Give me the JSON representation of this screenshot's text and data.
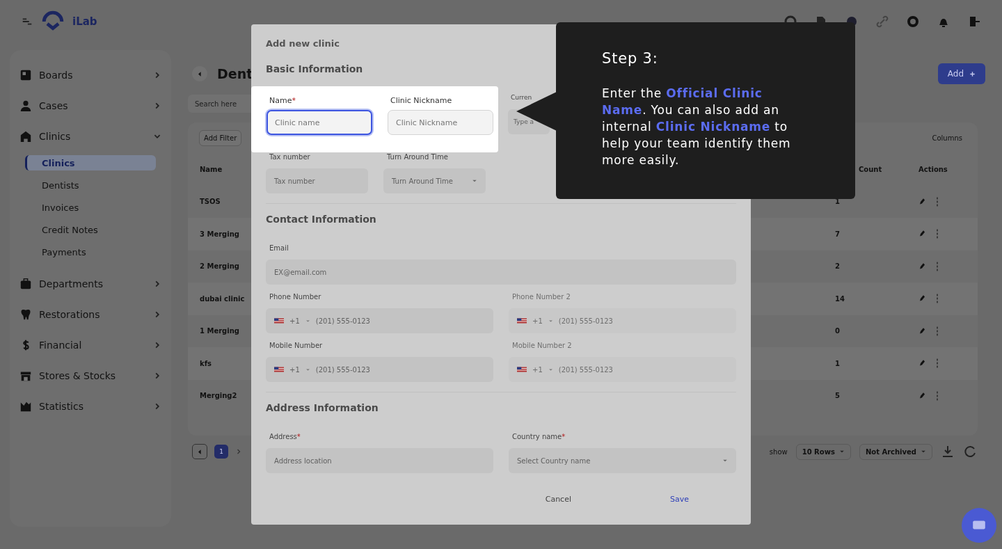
{
  "header": {
    "brand": "iLab"
  },
  "sidebar": {
    "items": [
      {
        "label": "Boards",
        "expanded": false
      },
      {
        "label": "Cases",
        "expanded": false
      },
      {
        "label": "Clinics",
        "expanded": true,
        "children": [
          {
            "label": "Clinics",
            "selected": true
          },
          {
            "label": "Dentists",
            "selected": false
          },
          {
            "label": "Invoices",
            "selected": false
          },
          {
            "label": "Credit Notes",
            "selected": false
          },
          {
            "label": "Payments",
            "selected": false
          }
        ]
      },
      {
        "label": "Departments",
        "expanded": false
      },
      {
        "label": "Restorations",
        "expanded": false
      },
      {
        "label": "Financial",
        "expanded": false
      },
      {
        "label": "Stores & Stocks",
        "expanded": false
      },
      {
        "label": "Statistics",
        "expanded": false
      }
    ]
  },
  "page": {
    "title": "Dent",
    "add_button": "Add",
    "search": {
      "placeholder": "Search here"
    }
  },
  "table": {
    "filter_button": "Add Filter",
    "columns_button": "Columns",
    "columns": [
      "Name",
      "Count",
      "Actions"
    ],
    "rows": [
      {
        "name": "TSOS",
        "case_count": "1"
      },
      {
        "name": "3 Merging",
        "case_count": "7"
      },
      {
        "name": "2 Merging",
        "case_count": "2"
      },
      {
        "name": "dubai clinic",
        "case_count": "14"
      },
      {
        "name": "1 Merging",
        "case_count": "0"
      },
      {
        "name": "kfs",
        "case_count": "1"
      },
      {
        "name": "Merging2",
        "case_count": "5"
      }
    ],
    "pages": [
      {
        "label": "1",
        "selected": true
      }
    ],
    "rows_label": "show",
    "rows_select": "10 Rows",
    "archive_select": "Not Archived"
  },
  "modal": {
    "title": "Add new clinic",
    "sections": [
      {
        "title": "Basic Information",
        "rows": [
          [
            {
              "kind": "spot"
            },
            {
              "kind": "text",
              "label": "Curren",
              "placeholder": "Type a",
              "disabled": false
            }
          ],
          [
            {
              "kind": "text",
              "label": "Tax number",
              "placeholder": "Tax number",
              "disabled": false
            },
            {
              "kind": "select",
              "label": "Turn Around Time",
              "placeholder": "Turn Around Time",
              "disabled": false
            }
          ]
        ]
      },
      {
        "title": "Contact Information",
        "rows": [
          [
            {
              "kind": "text",
              "label": "Email",
              "placeholder": "EX@email.com",
              "disabled": false
            }
          ],
          [
            {
              "kind": "phone",
              "label": "Phone Number",
              "code": "+1",
              "placeholder": "(201) 555-0123",
              "disabled": false
            },
            {
              "kind": "phone",
              "label": "Phone Number 2",
              "code": "+1",
              "placeholder": "(201) 555-0123",
              "disabled": true
            }
          ],
          [
            {
              "kind": "phone",
              "label": "Mobile Number",
              "code": "+1",
              "placeholder": "(201) 555-0123",
              "disabled": false
            },
            {
              "kind": "phone",
              "label": "Mobile Number 2",
              "code": "+1",
              "placeholder": "(201) 555-0123",
              "disabled": true
            }
          ]
        ]
      },
      {
        "title": "Address Information",
        "rows": [
          [
            {
              "kind": "text",
              "label": "Address",
              "required_mark": "*",
              "placeholder": "Address location",
              "disabled": false
            },
            {
              "kind": "select",
              "label": "Country name",
              "required_mark": "*",
              "placeholder": "Select Country name",
              "disabled": false
            }
          ]
        ]
      }
    ],
    "buttons": [
      {
        "label": "Cancel",
        "kind": "plain"
      },
      {
        "label": "Save",
        "kind": "primary"
      }
    ]
  },
  "spotlight": {
    "fields": [
      {
        "label": "Name",
        "required_mark": "*",
        "placeholder": "Clinic name",
        "focused": true
      },
      {
        "label": "Clinic Nickname",
        "placeholder": "Clinic Nickname",
        "focused": false
      }
    ]
  },
  "tour": {
    "title": "Step 3:",
    "text": "Enter the **Official Clinic Name**. You can also add an internal **Clinic Nickname** to help your team identify them more easily."
  }
}
